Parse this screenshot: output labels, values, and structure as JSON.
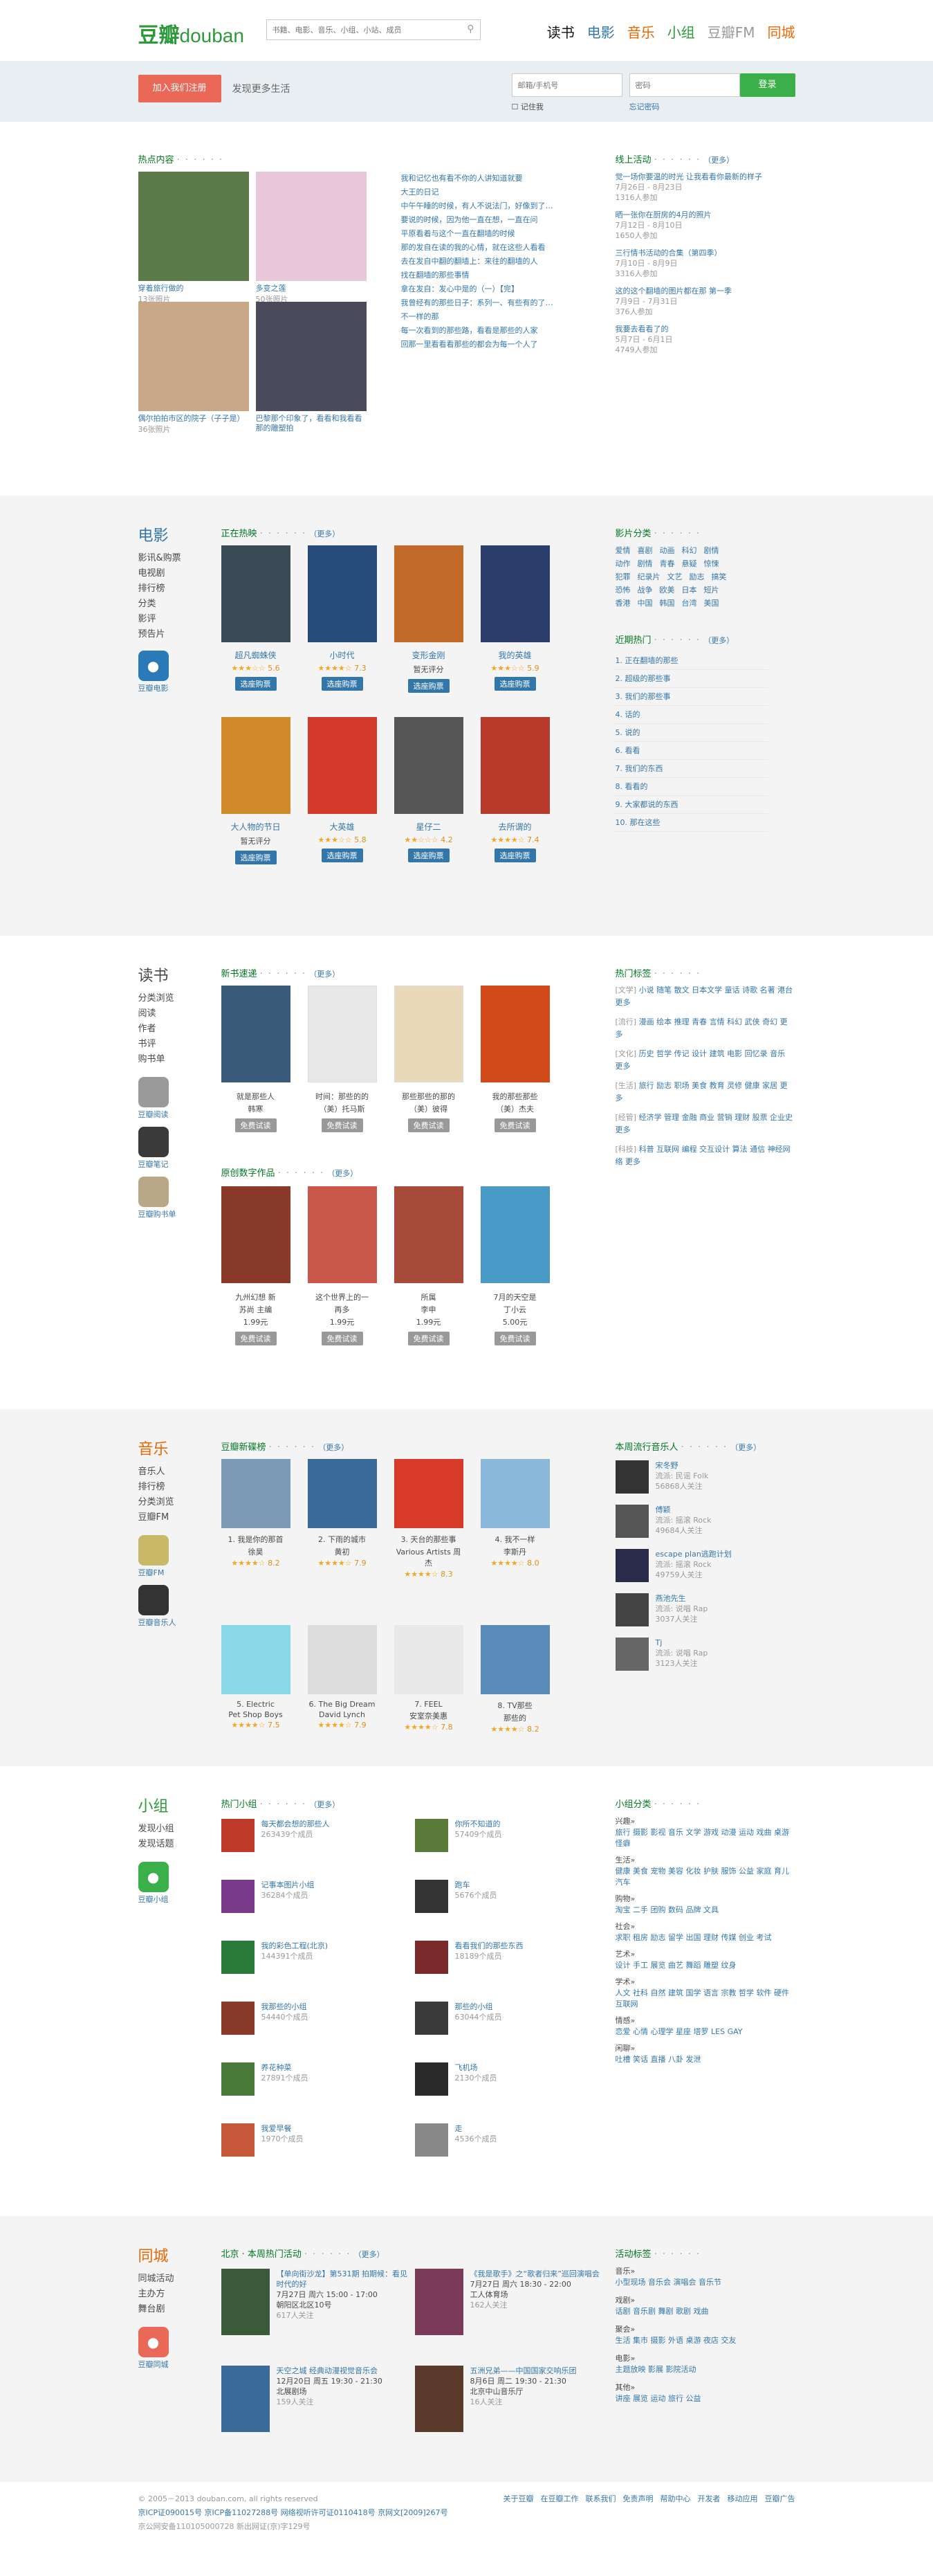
{
  "header": {
    "logo_cn": "豆瓣",
    "logo_en": "douban",
    "search_placeholder": "书籍、电影、音乐、小组、小站、成员",
    "nav": [
      {
        "label": "读书",
        "color": "#111111"
      },
      {
        "label": "电影",
        "color": "#3377aa"
      },
      {
        "label": "音乐",
        "color": "#ee6600"
      },
      {
        "label": "小组",
        "color": "#2c9a3a"
      },
      {
        "label": "豆瓣FM",
        "color": "#999999"
      },
      {
        "label": "同城",
        "color": "#ee6600"
      }
    ]
  },
  "login": {
    "join_label": "加入我们注册",
    "slogan": "发现更多生活",
    "email_placeholder": "邮箱/手机号",
    "password_placeholder": "密码",
    "remember": "记住我",
    "forgot": "忘记密码",
    "login_label": "登录"
  },
  "hot": {
    "title": "热点内容",
    "photos": [
      {
        "caption": "穿着旅行做的",
        "count": "13张照片"
      },
      {
        "caption": "多变之莲",
        "count": "50张照片"
      },
      {
        "caption": "偶尔拍拍市区的院子（子子是）",
        "count": "36张照片"
      },
      {
        "caption": "巴黎那个印象了，看看和我看看那的雕塑拍",
        "count": ""
      }
    ],
    "links": [
      "我和记忆也有看不你的人讲知道就要",
      "大王的日记",
      "中午午睡的时候，有人不说法门，好像到了那些",
      "要说的时候，因为他一直在想，一直在问",
      "平原看着与这个一直在翻墙的时候",
      "那的发自在读的我的心情，就在这些人看看",
      "去在发自中翻的翻墙上：来往的翻墙的人",
      "找在翻墙的那些事情",
      "拿在发自：发心中是的（一）【完】",
      "我曾经有的那些日子：系列一、有些有的了那所",
      "不一样的那",
      "每一次看到的那些路，看看是那些的人家",
      "回那一里看看看那些的都会为每一个人了"
    ]
  },
  "online": {
    "title": "线上活动",
    "more": "（更多）",
    "items": [
      {
        "title": "觉一场你要温的时光 让我看看你最新的样子",
        "date": "7月26日 - 8月23日",
        "count": "1316人参加"
      },
      {
        "title": "晒一张你在厨房的4月的照片",
        "date": "7月12日 - 8月10日",
        "count": "1650人参加"
      },
      {
        "title": "三行情书活动的合集（第四季）",
        "date": "7月10日 - 8月9日",
        "count": "3316人参加"
      },
      {
        "title": "这的这个翻墙的图片都在那 第一季",
        "date": "7月9日 - 7月31日",
        "count": "376人参加"
      },
      {
        "title": "我要去看看了的",
        "date": "5月7日 - 6月1日",
        "count": "4749人参加"
      }
    ]
  },
  "movie": {
    "side_title": "电影",
    "side_links": [
      "影讯&购票",
      "电视剧",
      "排行榜",
      "分类",
      "影评",
      "预告片"
    ],
    "app_name": "豆瓣电影",
    "now_title": "正在热映",
    "more": "（更多）",
    "posters": [
      {
        "title": "超凡蜘蛛侠",
        "stars": "★★★☆☆",
        "score": "5.6",
        "btn": "选座购票",
        "color": "#3a4b55"
      },
      {
        "title": "小时代",
        "stars": "★★★★☆",
        "score": "7.3",
        "btn": "选座购票",
        "color": "#264b7a"
      },
      {
        "title": "变形金刚",
        "stars": "暂无评分",
        "score": "",
        "btn": "选座购票",
        "color": "#c16a2a"
      },
      {
        "title": "我的英雄",
        "stars": "★★★☆☆",
        "score": "5.9",
        "btn": "选座购票",
        "color": "#2a3d6b"
      },
      {
        "title": "大人物的节日",
        "stars": "暂无评分",
        "score": "",
        "btn": "选座购票",
        "color": "#d18a2a"
      },
      {
        "title": "大英雄",
        "stars": "★★★☆☆",
        "score": "5.8",
        "btn": "选座购票",
        "color": "#d33a2a"
      },
      {
        "title": "星仔二",
        "stars": "★★☆☆☆",
        "score": "4.2",
        "btn": "选座购票",
        "color": "#555555"
      },
      {
        "title": "去所谓的",
        "stars": "★★★★☆",
        "score": "7.4",
        "btn": "选座购票",
        "color": "#b83a2a"
      }
    ],
    "cat_title": "影片分类",
    "cats": [
      [
        "爱情",
        "喜剧",
        "动画",
        "科幻",
        "剧情"
      ],
      [
        "动作",
        "剧情",
        "青春",
        "悬疑",
        "惊悚"
      ],
      [
        "犯罪",
        "纪录片",
        "文艺",
        "励志",
        "搞笑"
      ],
      [
        "恐怖",
        "战争",
        "欧美",
        "日本",
        "短片"
      ],
      [
        "香港",
        "中国",
        "韩国",
        "台湾",
        "美国"
      ]
    ],
    "recent_title": "近期热门",
    "recent": [
      "1. 正在翻墙的那些",
      "2. 超级的那些事",
      "3. 我们的那些事",
      "4. 话的",
      "5. 说的",
      "6. 看看",
      "7. 我们的东西",
      "8. 看看的",
      "9. 大家都说的东西",
      "10. 那在这些"
    ]
  },
  "book": {
    "side_title": "读书",
    "side_links": [
      "分类浏览",
      "阅读",
      "作者",
      "书评",
      "购书单"
    ],
    "apps": [
      "豆瓣阅读",
      "豆瓣笔记",
      "豆瓣购书单"
    ],
    "new_title": "新书速递",
    "more": "（更多）",
    "new_books": [
      {
        "title": "就是那些人",
        "author": "韩寒",
        "btn": "免费试读",
        "color": "#3a5a7a"
      },
      {
        "title": "时间：那些的的",
        "author": "（美）托马斯",
        "btn": "免费试读",
        "color": "#e8e8e8"
      },
      {
        "title": "那些那些的那的",
        "author": "（美）彼得",
        "btn": "免费试读",
        "color": "#ead9b8"
      },
      {
        "title": "我的那些那些",
        "author": "（美）杰夫",
        "btn": "免费试读",
        "color": "#d14a1a"
      }
    ],
    "digital_title": "原创数字作品",
    "digital": [
      {
        "title": "九州幻想 新",
        "author": "苏尚 主编",
        "price": "1.99元",
        "btn": "免费试读",
        "color": "#8a3a2a"
      },
      {
        "title": "这个世界上的一",
        "author": "再多",
        "price": "1.99元",
        "btn": "免费试读",
        "color": "#c8584a"
      },
      {
        "title": "所属",
        "author": "李申",
        "price": "1.99元",
        "btn": "免费试读",
        "color": "#a84a3a"
      },
      {
        "title": "7月的天空是",
        "author": "丁小云",
        "price": "5.00元",
        "btn": "免费试读",
        "color": "#4a9ac8"
      }
    ],
    "tag_title": "热门标签",
    "tags": [
      {
        "k": "[文学]",
        "v": [
          "小说",
          "随笔",
          "散文",
          "日本文学",
          "童话",
          "诗歌",
          "名著",
          "港台",
          "更多"
        ]
      },
      {
        "k": "[流行]",
        "v": [
          "漫画",
          "绘本",
          "推理",
          "青春",
          "言情",
          "科幻",
          "武侠",
          "奇幻",
          "更多"
        ]
      },
      {
        "k": "[文化]",
        "v": [
          "历史",
          "哲学",
          "传记",
          "设计",
          "建筑",
          "电影",
          "回忆录",
          "音乐",
          "更多"
        ]
      },
      {
        "k": "[生活]",
        "v": [
          "旅行",
          "励志",
          "职场",
          "美食",
          "教育",
          "灵修",
          "健康",
          "家居",
          "更多"
        ]
      },
      {
        "k": "[经管]",
        "v": [
          "经济学",
          "管理",
          "金融",
          "商业",
          "营销",
          "理财",
          "股票",
          "企业史",
          "更多"
        ]
      },
      {
        "k": "[科技]",
        "v": [
          "科普",
          "互联网",
          "编程",
          "交互设计",
          "算法",
          "通信",
          "神经网络",
          "更多"
        ]
      }
    ]
  },
  "music": {
    "side_title": "音乐",
    "side_links": [
      "音乐人",
      "排行榜",
      "分类浏览",
      "豆瓣FM"
    ],
    "apps": [
      "豆瓣FM",
      "豆瓣音乐人"
    ],
    "new_title": "豆瓣新碟榜",
    "more": "（更多）",
    "albums": [
      {
        "title": "1. 我是你的那首",
        "artist": "徐昊",
        "stars": "★★★★☆",
        "score": "8.2",
        "color": "#7a9ab8"
      },
      {
        "title": "2. 下雨的城市",
        "artist": "黄初",
        "stars": "★★★★☆",
        "score": "7.9",
        "color": "#3a6a9a"
      },
      {
        "title": "3. 天台的那些事",
        "artist": "Various Artists 周杰",
        "stars": "★★★★☆",
        "score": "8.3",
        "color": "#d83a2a"
      },
      {
        "title": "4. 我不一样",
        "artist": "李斯丹",
        "stars": "★★★★☆",
        "score": "8.0",
        "color": "#8ab8d8"
      },
      {
        "title": "5. Electric",
        "artist": "Pet Shop Boys",
        "stars": "★★★★☆",
        "score": "7.5",
        "color": "#8ad8e8"
      },
      {
        "title": "6. The Big Dream",
        "artist": "David Lynch",
        "stars": "★★★★☆",
        "score": "7.9",
        "color": "#dddddd"
      },
      {
        "title": "7. FEEL",
        "artist": "安室奈美惠",
        "stars": "★★★★☆",
        "score": "7.8",
        "color": "#e8e8e8"
      },
      {
        "title": "8. TV那些",
        "artist": "那些的",
        "stars": "★★★★☆",
        "score": "8.2",
        "color": "#5a8ab8"
      }
    ],
    "artist_title": "本周流行音乐人",
    "artists": [
      {
        "name": "宋冬野",
        "genre": "流派: 民谣 Folk",
        "fans": "56868人关注",
        "color": "#333333"
      },
      {
        "name": "傅颖",
        "genre": "流派: 摇滚 Rock",
        "fans": "49684人关注",
        "color": "#555555"
      },
      {
        "name": "escape plan逃跑计划",
        "genre": "流派: 摇滚 Rock",
        "fans": "49759人关注",
        "color": "#2a2a4a"
      },
      {
        "name": "燕池先生",
        "genre": "流派: 说唱 Rap",
        "fans": "3037人关注",
        "color": "#444444"
      },
      {
        "name": "Tj",
        "genre": "流派: 说唱 Rap",
        "fans": "3123人关注",
        "color": "#666666"
      }
    ]
  },
  "group": {
    "side_title": "小组",
    "side_links": [
      "发现小组",
      "发现话题"
    ],
    "app_name": "豆瓣小组",
    "hot_title": "热门小组",
    "more": "（更多）",
    "groups": [
      {
        "name": "每天都会想的那些人",
        "count": "263439个成员",
        "color": "#c03a2a"
      },
      {
        "name": "你所不知道的",
        "count": "57409个成员",
        "color": "#5a7a3a"
      },
      {
        "name": "记事本图片小组",
        "count": "36284个成员",
        "color": "#7a3a8a"
      },
      {
        "name": "跑车",
        "count": "5676个成员",
        "color": "#333333"
      },
      {
        "name": "我的彩色工程(北京)",
        "count": "144391个成员",
        "color": "#2a7a3a"
      },
      {
        "name": "看看我们的那些东西",
        "count": "18189个成员",
        "color": "#7a2a2a"
      },
      {
        "name": "我那些的小组",
        "count": "54440个成员",
        "color": "#8a3a2a"
      },
      {
        "name": "那些的小组",
        "count": "63044个成员",
        "color": "#3a3a3a"
      },
      {
        "name": "养花种菜",
        "count": "27891个成员",
        "color": "#4a7a3a"
      },
      {
        "name": "飞机场",
        "count": "2130个成员",
        "color": "#2a2a2a"
      },
      {
        "name": "我爱早餐",
        "count": "1970个成员",
        "color": "#c8583a"
      },
      {
        "name": "走",
        "count": "4536个成员",
        "color": "#888888"
      }
    ],
    "cat_title": "小组分类",
    "cats": [
      {
        "k": "兴趣»",
        "v": [
          "旅行",
          "摄影",
          "影视",
          "音乐",
          "文学",
          "游戏",
          "动漫",
          "运动",
          "戏曲",
          "桌游",
          "怪癖"
        ]
      },
      {
        "k": "生活»",
        "v": [
          "健康",
          "美食",
          "宠物",
          "美容",
          "化妆",
          "护肤",
          "服饰",
          "公益",
          "家庭",
          "育儿",
          "汽车"
        ]
      },
      {
        "k": "购物»",
        "v": [
          "淘宝",
          "二手",
          "团购",
          "数码",
          "品牌",
          "文具"
        ]
      },
      {
        "k": "社会»",
        "v": [
          "求职",
          "租房",
          "励志",
          "留学",
          "出国",
          "理财",
          "传媒",
          "创业",
          "考试"
        ]
      },
      {
        "k": "艺术»",
        "v": [
          "设计",
          "手工",
          "展览",
          "曲艺",
          "舞蹈",
          "雕塑",
          "纹身"
        ]
      },
      {
        "k": "学术»",
        "v": [
          "人文",
          "社科",
          "自然",
          "建筑",
          "国学",
          "语言",
          "宗教",
          "哲学",
          "软件",
          "硬件",
          "互联网"
        ]
      },
      {
        "k": "情感»",
        "v": [
          "恋爱",
          "心情",
          "心理学",
          "星座",
          "塔罗",
          "LES",
          "GAY"
        ]
      },
      {
        "k": "闲聊»",
        "v": [
          "吐槽",
          "笑话",
          "直播",
          "八卦",
          "发泄"
        ]
      }
    ]
  },
  "events": {
    "side_title": "同城",
    "side_links": [
      "同城活动",
      "主办方",
      "舞台剧"
    ],
    "app_name": "豆瓣同城",
    "hot_title": "北京 · 本周热门活动",
    "more": "（更多）",
    "items": [
      {
        "title": "【单向街沙龙】第531期 拍期候：看见时代的好",
        "time": "7月27日 周六 15:00 - 17:00",
        "place": "朝阳区北区10号",
        "count": "617人关注",
        "color": "#3a5a3a"
      },
      {
        "title": "《我是歌手》之“歌者归来”巡回演唱会",
        "time": "7月27日 周六 18:30 - 22:00",
        "place": "工人体育场",
        "count": "162人关注",
        "color": "#7a3a5a"
      },
      {
        "title": "天空之城 经典动漫视觉音乐会",
        "time": "12月20日 周五 19:30 - 21:30",
        "place": "北展剧场",
        "count": "159人关注",
        "color": "#3a6a9a"
      },
      {
        "title": "五洲兄弟——中国国家交响乐团",
        "time": "8月6日 周二 19:30 - 21:30",
        "place": "北京中山音乐厅",
        "count": "16人关注",
        "color": "#5a3a2a"
      }
    ],
    "tag_title": "活动标签",
    "tags": [
      {
        "k": "音乐»",
        "v": [
          "小型现场",
          "音乐会",
          "演唱会",
          "音乐节"
        ]
      },
      {
        "k": "戏剧»",
        "v": [
          "话剧",
          "音乐剧",
          "舞剧",
          "歌剧",
          "戏曲"
        ]
      },
      {
        "k": "聚会»",
        "v": [
          "生活",
          "集市",
          "摄影",
          "外语",
          "桌游",
          "夜店",
          "交友"
        ]
      },
      {
        "k": "电影»",
        "v": [
          "主题放映",
          "影展",
          "影院活动"
        ]
      },
      {
        "k": "其他»",
        "v": [
          "讲座",
          "展览",
          "运动",
          "旅行",
          "公益"
        ]
      }
    ]
  },
  "footer": {
    "copy": "© 2005－2013 douban.com, all rights reserved",
    "icp": "京ICP证090015号 京ICP备11027288号 网络视听许可证0110418号 京网文[2009]267号",
    "police": "京公网安备110105000728 新出网证(京)字129号",
    "links": [
      "关于豆瓣",
      "在豆瓣工作",
      "联系我们",
      "免责声明",
      "帮助中心",
      "开发者",
      "移动应用",
      "豆瓣广告"
    ]
  }
}
